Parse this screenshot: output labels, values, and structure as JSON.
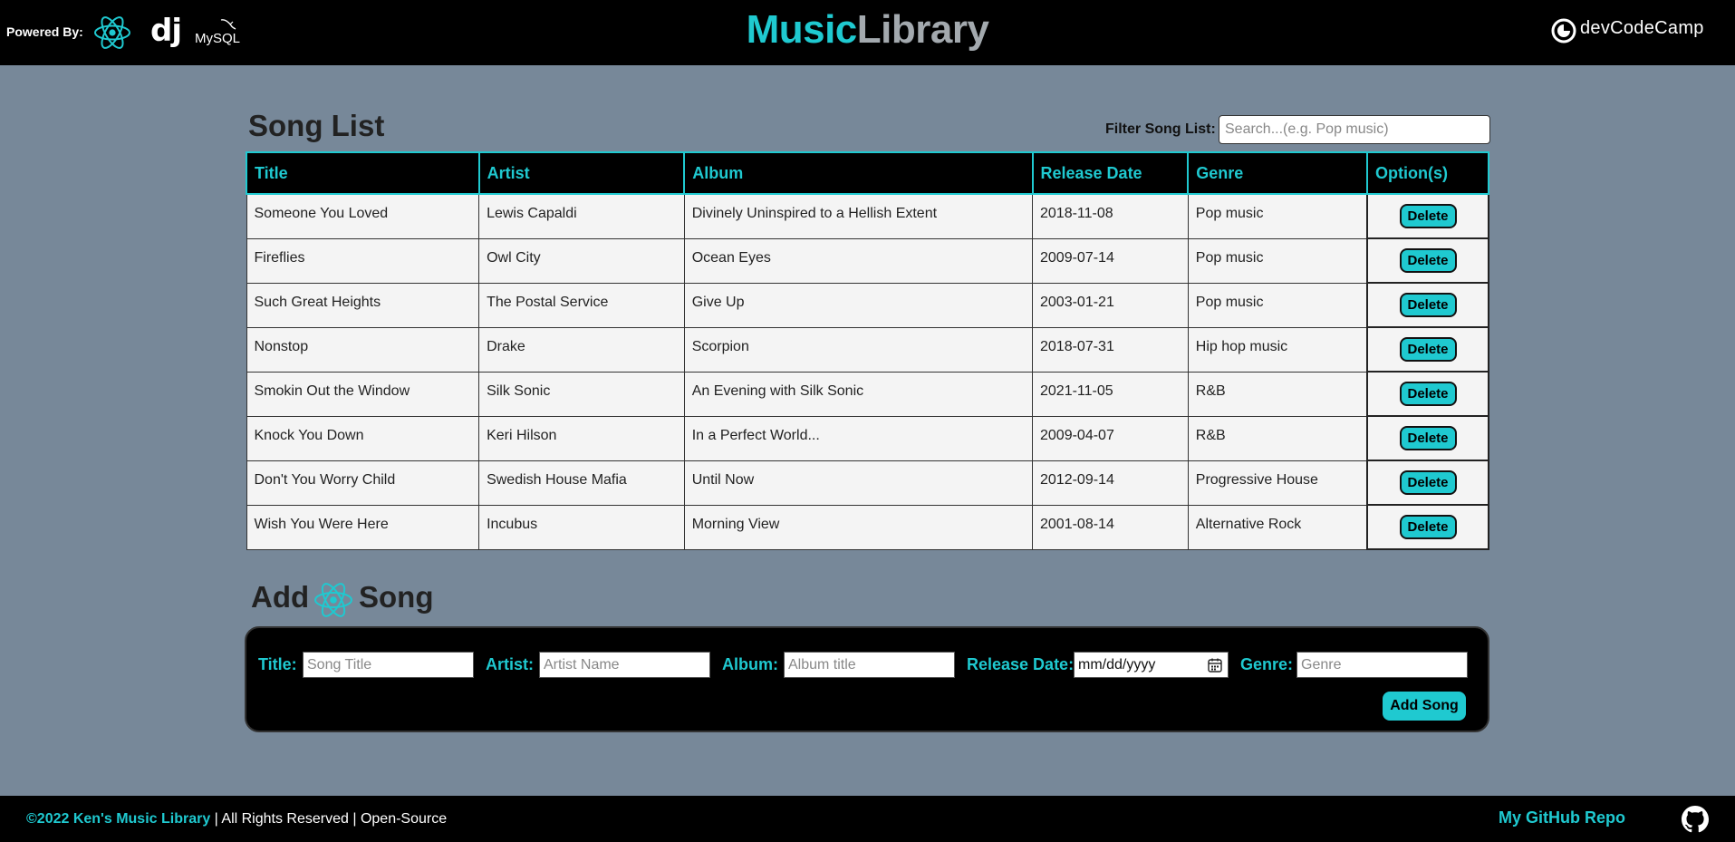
{
  "header": {
    "powered_by": "Powered By:",
    "dj_logo_text": "dj",
    "mysql_logo_text": "MySQL",
    "title_part1": "Music",
    "title_part2": "Library",
    "brand_text": "devCodeCamp"
  },
  "song_list": {
    "title": "Song List",
    "filter_label": "Filter Song List:",
    "filter_placeholder": "Search...(e.g. Pop music)",
    "columns": [
      "Title",
      "Artist",
      "Album",
      "Release Date",
      "Genre",
      "Option(s)"
    ],
    "delete_label": "Delete",
    "rows": [
      [
        "Someone You Loved",
        "Lewis Capaldi",
        "Divinely Uninspired to a Hellish Extent",
        "2018-11-08",
        "Pop music"
      ],
      [
        "Fireflies",
        "Owl City",
        "Ocean Eyes",
        "2009-07-14",
        "Pop music"
      ],
      [
        "Such Great Heights",
        "The Postal Service",
        "Give Up",
        "2003-01-21",
        "Pop music"
      ],
      [
        "Nonstop",
        "Drake",
        "Scorpion",
        "2018-07-31",
        "Hip hop music"
      ],
      [
        "Smokin Out the Window",
        "Silk Sonic",
        "An Evening with Silk Sonic",
        "2021-11-05",
        "R&B"
      ],
      [
        "Knock You Down",
        "Keri Hilson",
        "In a Perfect World...",
        "2009-04-07",
        "R&B"
      ],
      [
        "Don't You Worry Child",
        "Swedish House Mafia",
        "Until Now",
        "2012-09-14",
        "Progressive House"
      ],
      [
        "Wish You Were Here",
        "Incubus",
        "Morning View",
        "2001-08-14",
        "Alternative Rock"
      ]
    ]
  },
  "add_song": {
    "title_word1": "Add",
    "title_word2": "Song",
    "title_label": "Title:",
    "title_placeholder": "Song Title",
    "artist_label": "Artist:",
    "artist_placeholder": "Artist Name",
    "album_label": "Album:",
    "album_placeholder": "Album title",
    "release_label": "Release Date:",
    "release_placeholder": "mm/dd/yyyy",
    "genre_label": "Genre:",
    "genre_placeholder": "Genre",
    "submit_label": "Add Song"
  },
  "footer": {
    "copyright": "©2022 Ken's Music Library",
    "rights": " | All Rights Reserved | Open-Source",
    "github_link": "My GitHub Repo"
  },
  "colors": {
    "accent": "#1fc9d0",
    "background": "#778899",
    "bar": "#000000"
  },
  "icons": [
    "react-icon",
    "django-icon",
    "mysql-icon",
    "devcodecamp-icon",
    "calendar-icon",
    "github-icon"
  ]
}
